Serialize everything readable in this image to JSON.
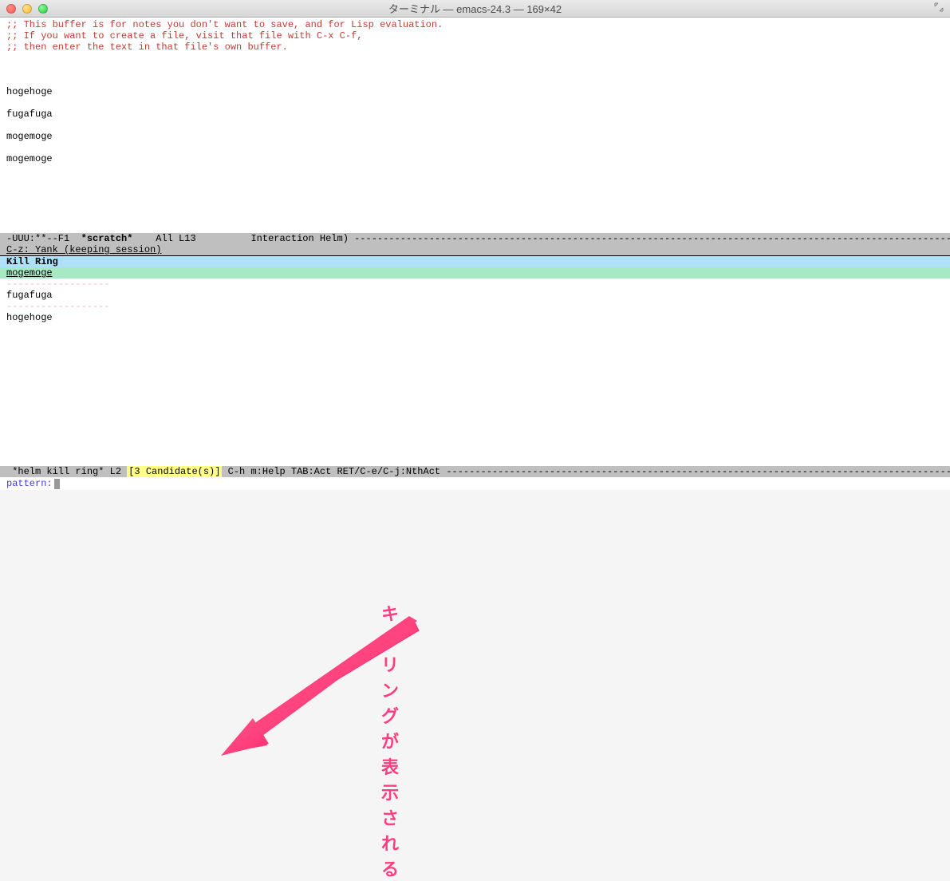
{
  "titlebar": {
    "title": "ターミナル — emacs-24.3 — 169×42"
  },
  "scratch": {
    "comment1": ";; This buffer is for notes you don't want to save, and for Lisp evaluation.",
    "comment2": ";; If you want to create a file, visit that file with C-x C-f,",
    "comment3": ";; then enter the text in that file's own buffer.",
    "lines": [
      "hogehoge",
      "fugafuga",
      "mogemoge",
      "mogemoge"
    ]
  },
  "modeline_top": {
    "left": "-UUU:**--F1  ",
    "buffer": "*scratch*",
    "mid": "    All L13    ",
    "mode": "Interaction Helm)",
    "dashes": " ----------------------------------------------------------------------------------------------------------------------------"
  },
  "helm": {
    "header": " C-z: Yank (keeping session)",
    "source_header": "Kill Ring",
    "selected": "mogemoge",
    "separator": "------------------",
    "candidates": [
      "fugafuga",
      "hogehoge"
    ]
  },
  "modeline_bottom": {
    "buffer": " *helm kill ring*",
    "pos": " L2 ",
    "count": "[3 Candidate(s)]",
    "help": " C-h m:Help TAB:Act RET/C-e/C-j:NthAct ",
    "dashes": "---------------------------------------------------------------------------------------------------------"
  },
  "minibuffer": {
    "prompt": "pattern: "
  },
  "annotation": {
    "text": "キルリングが表示される"
  }
}
